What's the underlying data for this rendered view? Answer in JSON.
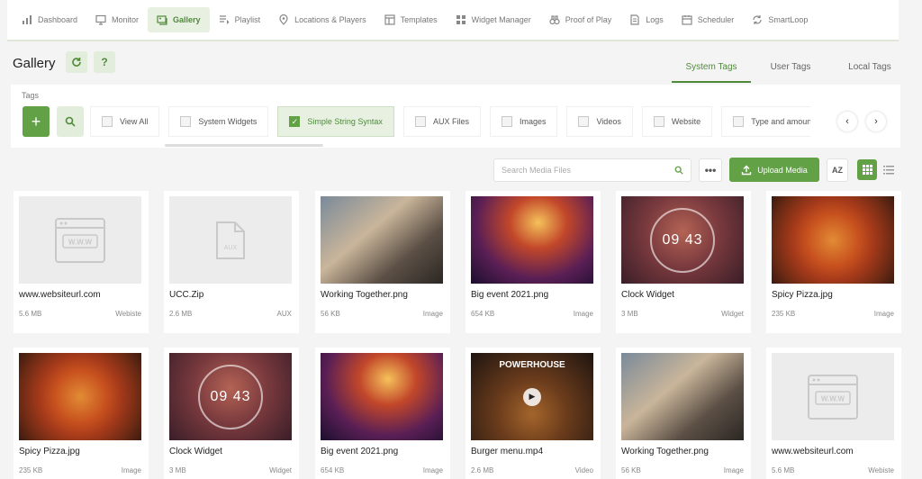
{
  "nav": [
    {
      "label": "Dashboard",
      "icon": "dashboard-icon"
    },
    {
      "label": "Monitor",
      "icon": "monitor-icon"
    },
    {
      "label": "Gallery",
      "icon": "gallery-icon",
      "active": true
    },
    {
      "label": "Playlist",
      "icon": "playlist-icon"
    },
    {
      "label": "Locations & Players",
      "icon": "location-pin-icon"
    },
    {
      "label": "Templates",
      "icon": "templates-icon"
    },
    {
      "label": "Widget Manager",
      "icon": "widget-grid-icon"
    },
    {
      "label": "Proof of Play",
      "icon": "binoculars-icon"
    },
    {
      "label": "Logs",
      "icon": "logs-icon"
    },
    {
      "label": "Scheduler",
      "icon": "calendar-icon"
    },
    {
      "label": "SmartLoop",
      "icon": "loop-icon"
    }
  ],
  "header": {
    "title": "Gallery",
    "refresh_icon": "refresh-icon",
    "help_label": "?"
  },
  "tabs": [
    {
      "label": "System Tags",
      "active": true
    },
    {
      "label": "User Tags"
    },
    {
      "label": "Local Tags"
    }
  ],
  "tags": {
    "label": "Tags",
    "add_label": "+",
    "chips": [
      {
        "label": "View All",
        "checked": false
      },
      {
        "label": "System Widgets",
        "checked": false
      },
      {
        "label": "Simple String Syntax",
        "checked": true
      },
      {
        "label": "AUX Files",
        "checked": false
      },
      {
        "label": "Images",
        "checked": false
      },
      {
        "label": "Videos",
        "checked": false
      },
      {
        "label": "Website",
        "checked": false
      },
      {
        "label": "Type and amount",
        "checked": false
      }
    ],
    "prev_label": "‹",
    "next_label": "›"
  },
  "toolbar": {
    "search_placeholder": "Search Media Files",
    "more_label": "•••",
    "upload_label": "Upload Media",
    "sort_label": "AZ"
  },
  "colors": {
    "accent": "#62a146",
    "accent_light": "#e7f0e1"
  },
  "media": [
    {
      "name": "www.websiteurl.com",
      "size": "5.6 MB",
      "type": "Webiste",
      "thumb": "website"
    },
    {
      "name": "UCC.Zip",
      "size": "2.6 MB",
      "type": "AUX",
      "thumb": "aux",
      "aux_label": "AUX"
    },
    {
      "name": "Working Together.png",
      "size": "56 KB",
      "type": "Image",
      "thumb": "people"
    },
    {
      "name": "Big event 2021.png",
      "size": "654 KB",
      "type": "Image",
      "thumb": "event"
    },
    {
      "name": "Clock Widget",
      "size": "3 MB",
      "type": "Widget",
      "thumb": "clock",
      "clock_text": "09 43"
    },
    {
      "name": "Spicy Pizza.jpg",
      "size": "235 KB",
      "type": "Image",
      "thumb": "pizza"
    },
    {
      "name": "Spicy Pizza.jpg",
      "size": "235 KB",
      "type": "Image",
      "thumb": "pizza"
    },
    {
      "name": "Clock Widget",
      "size": "3 MB",
      "type": "Widget",
      "thumb": "clock",
      "clock_text": "09 43"
    },
    {
      "name": "Big event 2021.png",
      "size": "654 KB",
      "type": "Image",
      "thumb": "event"
    },
    {
      "name": "Burger menu.mp4",
      "size": "2.6 MB",
      "type": "Video",
      "thumb": "burger",
      "overlay_title": "POWERHOUSE"
    },
    {
      "name": "Working Together.png",
      "size": "56 KB",
      "type": "Image",
      "thumb": "people"
    },
    {
      "name": "www.websiteurl.com",
      "size": "5.6 MB",
      "type": "Webiste",
      "thumb": "website"
    }
  ]
}
